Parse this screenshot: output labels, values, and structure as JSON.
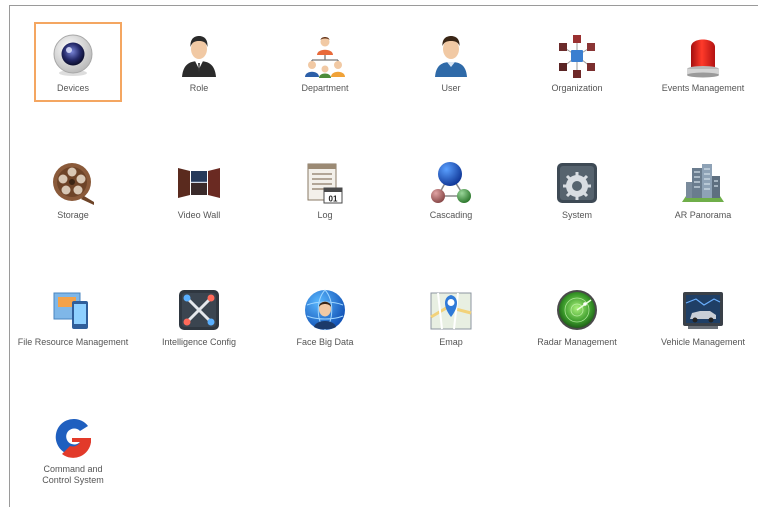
{
  "tiles": [
    {
      "label": "Devices",
      "icon": "camera-lens-icon",
      "selected": true
    },
    {
      "label": "Role",
      "icon": "businessman-icon"
    },
    {
      "label": "Department",
      "icon": "org-people-icon"
    },
    {
      "label": "User",
      "icon": "user-icon"
    },
    {
      "label": "Organization",
      "icon": "cubes-network-icon"
    },
    {
      "label": "Events Management",
      "icon": "red-alarm-light-icon"
    },
    {
      "label": "Storage",
      "icon": "film-reel-icon"
    },
    {
      "label": "Video Wall",
      "icon": "video-wall-icon"
    },
    {
      "label": "Log",
      "icon": "log-calendar-icon"
    },
    {
      "label": "Cascading",
      "icon": "cascading-nodes-icon"
    },
    {
      "label": "System",
      "icon": "system-gear-icon"
    },
    {
      "label": "AR Panorama",
      "icon": "city-buildings-icon"
    },
    {
      "label": "File Resource Management",
      "icon": "file-resource-icon"
    },
    {
      "label": "Intelligence Config",
      "icon": "intelligence-config-icon"
    },
    {
      "label": "Face Big Data",
      "icon": "face-globe-icon"
    },
    {
      "label": "Emap",
      "icon": "map-pin-icon"
    },
    {
      "label": "Radar Management",
      "icon": "radar-icon"
    },
    {
      "label": "Vehicle Management",
      "icon": "vehicle-screen-icon"
    },
    {
      "label": "Command and Control System",
      "icon": "command-control-logo-icon"
    }
  ],
  "colors": {
    "selection_border": "#f4a661",
    "label_text": "#555555",
    "frame_line": "#9a9a9a"
  }
}
